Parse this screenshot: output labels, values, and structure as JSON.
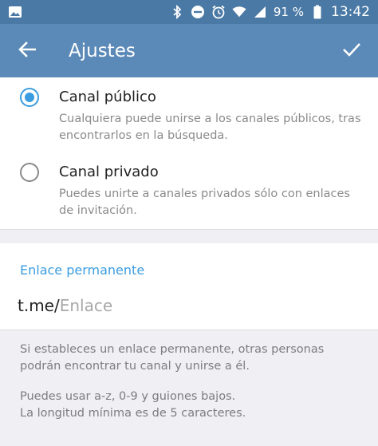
{
  "status_bar": {
    "battery": "91 %",
    "time": "13:42"
  },
  "app_bar": {
    "title": "Ajustes",
    "back_icon": "arrow-back-icon",
    "done_icon": "check-icon"
  },
  "options": {
    "public": {
      "title": "Canal público",
      "description": "Cualquiera puede unirse a los canales públicos, tras encontrarlos en la búsqueda.",
      "selected": true
    },
    "private": {
      "title": "Canal privado",
      "description": "Puedes unirte a canales privados sólo con enlaces de invitación.",
      "selected": false
    }
  },
  "link": {
    "header": "Enlace permanente",
    "prefix": "t.me/",
    "placeholder": "Enlace",
    "value": ""
  },
  "info": {
    "paragraph1": "Si estableces un enlace permanente, otras personas podrán encontrar tu canal y unirse a él.",
    "paragraph2_line1": "Puedes usar a-z, 0-9 y guiones bajos.",
    "paragraph2_line2": "La longitud mínima es de 5 caracteres."
  },
  "colors": {
    "app_bar": "#5b8ab8",
    "status_bar": "#4a79a5",
    "accent": "#3b9de0"
  }
}
